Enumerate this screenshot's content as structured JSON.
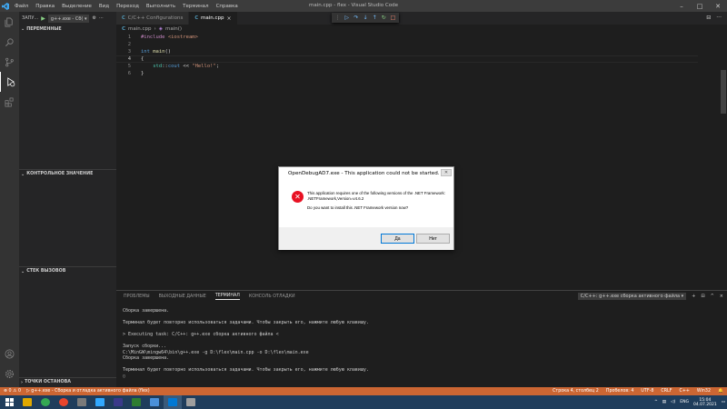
{
  "titlebar": {
    "menu": [
      "Файл",
      "Правка",
      "Выделение",
      "Вид",
      "Переход",
      "Выполнить",
      "Терминал",
      "Справка"
    ],
    "window_title": "main.cpp - flex - Visual Studio Code",
    "minimize": "–",
    "maximize": "□",
    "close": "✕"
  },
  "sidebar": {
    "run_label": "ЗАПУ...",
    "run_icon": "▶",
    "config_value": "g++.exe - Сб( ▾",
    "gear": "⚙",
    "more": "···",
    "sections": {
      "variables": "ПЕРЕМЕННЫЕ",
      "watch": "КОНТРОЛЬНОЕ ЗНАЧЕНИЕ",
      "call_stack": "СТЕК ВЫЗОВОВ",
      "breakpoints": "ТОЧКИ ОСТАНОВА"
    }
  },
  "tabs": [
    {
      "icon": "C",
      "label": "C/C++ Configurations",
      "active": false
    },
    {
      "icon": "C",
      "label": "main.cpp",
      "active": true,
      "close": "×"
    }
  ],
  "debugbar": {
    "grip": "⋮",
    "continue": "▷",
    "step_over": "↷",
    "step_into": "↓",
    "step_out": "↑",
    "restart": "↻",
    "stop": "□"
  },
  "editor_actions": {
    "split": "⊟",
    "more": "···"
  },
  "breadcrumb": {
    "file": "main.cpp",
    "sep": "›",
    "symbol": "main()"
  },
  "code": [
    {
      "n": "1",
      "parts": [
        {
          "c": "kw",
          "t": "#include "
        },
        {
          "c": "str",
          "t": "<iostream>"
        }
      ]
    },
    {
      "n": "2",
      "parts": []
    },
    {
      "n": "3",
      "parts": [
        {
          "c": "kw2",
          "t": "int "
        },
        {
          "c": "fn",
          "t": "main"
        },
        {
          "c": "plain",
          "t": "()"
        }
      ]
    },
    {
      "n": "4",
      "parts": [
        {
          "c": "plain",
          "t": "{"
        }
      ]
    },
    {
      "n": "5",
      "parts": [
        {
          "c": "plain",
          "t": "    "
        },
        {
          "c": "ns",
          "t": "std"
        },
        {
          "c": "plain",
          "t": "::"
        },
        {
          "c": "kw2",
          "t": "cout"
        },
        {
          "c": "plain",
          "t": " << "
        },
        {
          "c": "str",
          "t": "\"Hello!\""
        },
        {
          "c": "plain",
          "t": ";"
        }
      ]
    },
    {
      "n": "6",
      "parts": [
        {
          "c": "plain",
          "t": "}"
        }
      ]
    }
  ],
  "panel": {
    "tabs": [
      "ПРОБЛЕМЫ",
      "ВЫХОДНЫЕ ДАННЫЕ",
      "ТЕРМИНАЛ",
      "КОНСОЛЬ ОТЛАДКИ"
    ],
    "active_tab": 2,
    "terminal_select": "C/C++: g++.exe сборка активного файла ▾",
    "add": "+",
    "split": "⊟",
    "trash": "🗑",
    "maximize": "^",
    "close": "×",
    "terminal_text": "Сборка завершена.\n\nТерминал будет повторно использоваться задачами. Чтобы закрыть его, нажмите любую клавишу.\n\n> Executing task: C/C++: g++.exe сборка активного файла <\n\nЗапуск сборки...\nC:\\MinGW\\mingw64\\bin\\g++.exe -g D:\\flex\\main.cpp -o D:\\flex\\main.exe\nСборка завершена.\n\nТерминал будет повторно использоваться задачами. Чтобы закрыть его, нажмите любую клавишу.\n▯"
  },
  "statusbar": {
    "left": [
      "⊗ 0  ⚠ 0",
      "▷ g++.exe - Сборка и отладка активного файла (flex)"
    ],
    "right": [
      "Строка 4, столбец 2",
      "Пробелов: 4",
      "UTF-8",
      "CRLF",
      "C++",
      "Win32",
      "🔔"
    ]
  },
  "dialog": {
    "title": "OpenDebugAD7.exe - This application could not be started.",
    "close": "✕",
    "line1": "This application requires one of the following versions of the .NET Framework:",
    "line2": ".NETFramework,Version=v4.6.2",
    "line3": "Do you want to install this .NET Framework version now?",
    "yes": "Да",
    "no": "Нет"
  },
  "taskbar": {
    "lang": "ENG",
    "time": "15:04",
    "date": "04.07.2021",
    "apps": [
      "#e0a800",
      "#34a853",
      "#e8452c",
      "#7a7a7a",
      "#31a8ff",
      "#3a3a8a",
      "#2e7d32",
      "#4a90d9",
      "#0078d4",
      "#9e9e9e"
    ]
  }
}
